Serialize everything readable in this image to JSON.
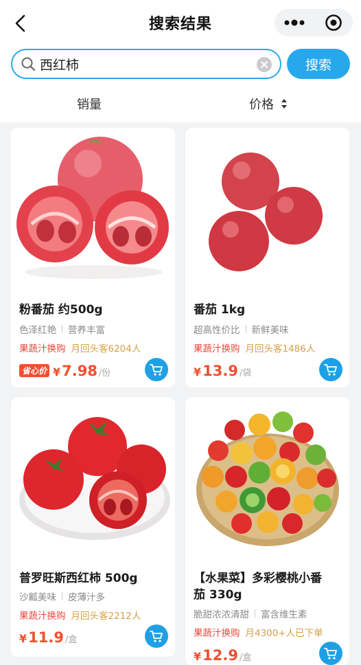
{
  "header": {
    "title": "搜索结果",
    "back_icon": "chevron-left-icon",
    "menu_icon": "more-dots-icon",
    "close_icon": "target-icon"
  },
  "search": {
    "value": "西红柿",
    "placeholder": "",
    "button_label": "搜索"
  },
  "sort": {
    "sales_label": "销量",
    "price_label": "价格"
  },
  "colors": {
    "accent": "#28a8ec",
    "price": "#f0502f",
    "promo": "#e8473a",
    "promo_gold": "#d4a04a"
  },
  "products": [
    {
      "title": "粉番茄 约500g",
      "tags": [
        "色泽红艳",
        "营养丰富"
      ],
      "promo": "果蔬汁换购",
      "promo_note": "月回头客6204人",
      "badge": "省心价",
      "yen": "¥",
      "price": "7.98",
      "unit": "/份"
    },
    {
      "title": "番茄 1kg",
      "tags": [
        "超高性价比",
        "新鲜美味"
      ],
      "promo": "果蔬汁换购",
      "promo_note": "月回头客1486人",
      "badge": "",
      "yen": "¥",
      "price": "13.9",
      "unit": "/袋"
    },
    {
      "title": "普罗旺斯西红柿 500g",
      "tags": [
        "沙瓤美味",
        "皮薄汁多"
      ],
      "promo": "果蔬汁换购",
      "promo_note": "月回头客2212人",
      "badge": "",
      "yen": "¥",
      "price": "11.9",
      "unit": "/盒"
    },
    {
      "title_line1": "【水果菜】多彩樱桃小番",
      "title_line2": "茄 330g",
      "tags": [
        "脆甜浓浓清甜",
        "富含维生素"
      ],
      "promo": "果蔬汁换购",
      "promo_note": "月4300+人已下单",
      "badge": "",
      "yen": "¥",
      "price": "12.9",
      "unit": "/盒"
    }
  ]
}
